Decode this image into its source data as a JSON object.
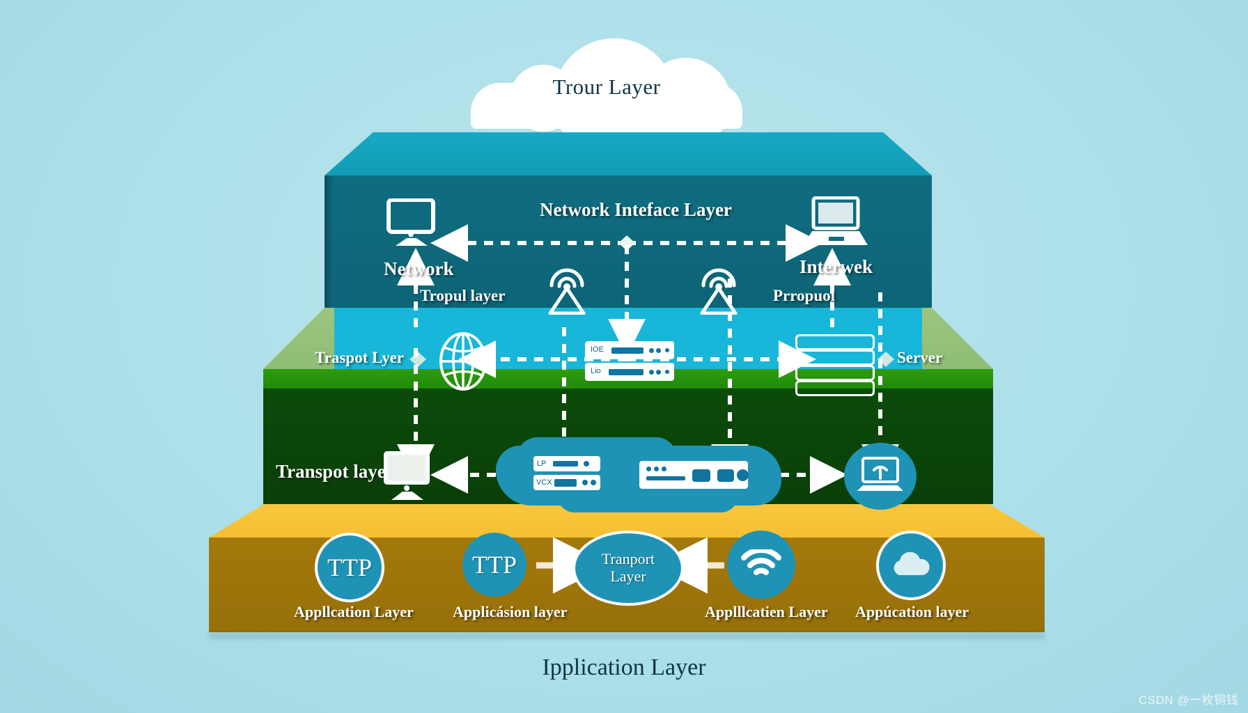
{
  "background_color": "#b3dfe8",
  "cloud": {
    "label": "Trour Layer",
    "text_color": "#0e3446"
  },
  "layers": [
    {
      "id": "network-interface",
      "title": "Network Inteface Layer",
      "color_top": "#17a9c4",
      "color_face": "#0f6d80",
      "labels": [
        {
          "name": "network",
          "text": "Network"
        },
        {
          "name": "tropul-layer",
          "text": "Tropul layer"
        },
        {
          "name": "interwek",
          "text": "Interwek"
        },
        {
          "name": "prropuol",
          "text": "Prropuol"
        }
      ],
      "icons": [
        "desktop-monitor-icon",
        "wifi-tower-icon",
        "wifi-tower-icon",
        "laptop-icon"
      ]
    },
    {
      "id": "transport-band",
      "title": "Traspot Lyer",
      "color_top": "#9cc57f",
      "color_band": "#18b6d8",
      "color_edge": "#2f9c0e",
      "labels": [
        {
          "name": "traspot-lyer",
          "text": "Traspot Lyer"
        },
        {
          "name": "server",
          "text": "Server"
        }
      ],
      "icons": [
        "globe-icon",
        "router-stack-icon",
        "server-rack-icon"
      ],
      "device_texts": [
        "IOE",
        "Lio"
      ]
    },
    {
      "id": "transpot-layer",
      "title": "Transpot layer",
      "color_face": "#0c4b0a",
      "labels": [
        {
          "name": "transpot-layer",
          "text": "Transpot layer"
        }
      ],
      "icons": [
        "desktop-monitor-icon",
        "switch-device-icon",
        "router-device-icon",
        "laptop-wifi-icon"
      ],
      "device_texts": [
        "LP",
        "VCX"
      ]
    },
    {
      "id": "application-layer",
      "title": "Ipplication Layer",
      "color_top": "#f8c73f",
      "color_face": "#a4790b",
      "nodes": [
        {
          "name": "node-ttp-1",
          "badge": "TTP",
          "label": "Appllcation Layer",
          "icon": "ttp-circle-icon"
        },
        {
          "name": "node-ttp-2",
          "badge": "TTP",
          "label": "Applicásion layer",
          "icon": "ttp-circle-icon"
        },
        {
          "name": "node-transport",
          "badge": "Tranport\nLayer",
          "label": "",
          "icon": "transport-oval-icon"
        },
        {
          "name": "node-wifi",
          "badge": "",
          "label": "Applllcatien Layer",
          "icon": "wifi-signal-icon"
        },
        {
          "name": "node-cloud",
          "badge": "",
          "label": "Appúcation layer",
          "icon": "cloud-dotted-icon"
        }
      ]
    }
  ],
  "bottom_title": "Ipplication Layer",
  "transport_oval": {
    "line1": "Tranport",
    "line2": "Layer"
  },
  "watermark": "CSDN @一枚铜钱",
  "accent_colors": {
    "teal_node": "#1f93b5",
    "dark_navy_text": "#0e3446",
    "white": "#ffffff"
  }
}
